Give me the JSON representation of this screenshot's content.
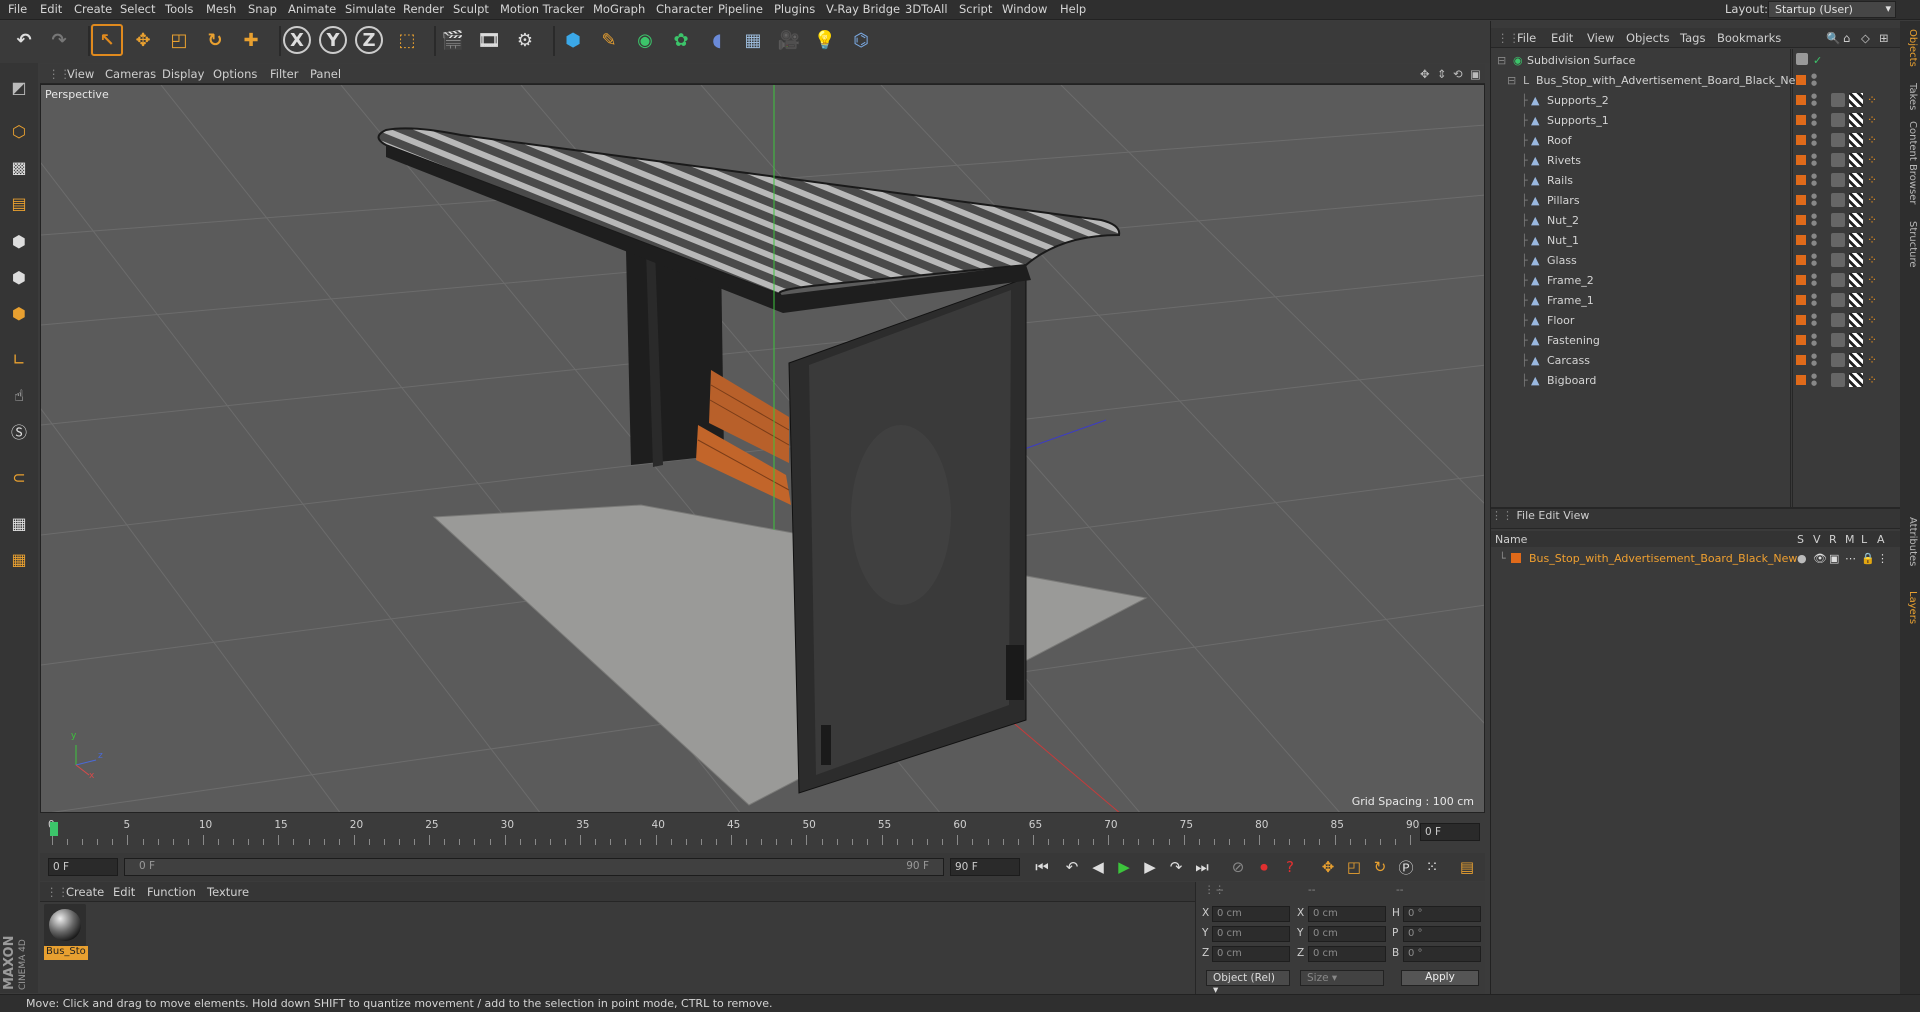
{
  "menubar": {
    "items": [
      "File",
      "Edit",
      "Create",
      "Select",
      "Tools",
      "Mesh",
      "Snap",
      "Animate",
      "Simulate",
      "Render",
      "Sculpt",
      "Motion Tracker",
      "MoGraph",
      "Character",
      "Pipeline",
      "Plugins",
      "V-Ray Bridge",
      "3DToAll",
      "Script",
      "Window",
      "Help"
    ],
    "layout_label": "Layout:",
    "layout_value": "Startup (User)"
  },
  "toolbar": {
    "x_label": "X",
    "y_label": "Y",
    "z_label": "Z"
  },
  "viewport": {
    "menu": [
      "View",
      "Cameras",
      "Display",
      "Options",
      "Filter",
      "Panel"
    ],
    "label": "Perspective",
    "grid_spacing": "Grid Spacing : 100 cm",
    "axis_y": "y",
    "axis_z": "z",
    "axis_x": "x"
  },
  "timeline": {
    "ticks": [
      "0",
      "5",
      "10",
      "15",
      "20",
      "25",
      "30",
      "35",
      "40",
      "45",
      "50",
      "55",
      "60",
      "65",
      "70",
      "75",
      "80",
      "85",
      "90"
    ],
    "current_frame_right": "0 F",
    "start_field": "0 F",
    "range_left": "0 F",
    "range_right": "90 F",
    "end_field": "90 F"
  },
  "material_panel": {
    "menu": [
      "Create",
      "Edit",
      "Function",
      "Texture"
    ],
    "material_name": "Bus_Sto"
  },
  "coord_panel": {
    "fields": {
      "pos_x": "0 cm",
      "pos_y": "0 cm",
      "pos_z": "0 cm",
      "size_x": "0 cm",
      "size_y": "0 cm",
      "size_z": "0 cm",
      "rot_h": "0 °",
      "rot_p": "0 °",
      "rot_b": "0 °"
    },
    "labels": {
      "x": "X",
      "y": "Y",
      "z": "Z",
      "h": "H",
      "p": "P",
      "b": "B"
    },
    "dash1": "--",
    "dash2": "--",
    "dash3": "--",
    "mode": "Object (Rel)",
    "size_mode": "Size",
    "apply": "Apply"
  },
  "object_manager": {
    "menu": [
      "File",
      "Edit",
      "View",
      "Objects",
      "Tags",
      "Bookmarks"
    ],
    "root": "Subdivision Surface",
    "group": "Bus_Stop_with_Advertisement_Board_Black_New",
    "children": [
      "Supports_2",
      "Supports_1",
      "Roof",
      "Rivets",
      "Rails",
      "Pillars",
      "Nut_2",
      "Nut_1",
      "Glass",
      "Frame_2",
      "Frame_1",
      "Floor",
      "Fastening",
      "Carcass",
      "Bigboard"
    ]
  },
  "layer_manager": {
    "menu": [
      "File",
      "Edit",
      "View"
    ],
    "header": {
      "name": "Name",
      "cols": [
        "S",
        "V",
        "R",
        "M",
        "L",
        "A"
      ]
    },
    "layer": "Bus_Stop_with_Advertisement_Board_Black_New"
  },
  "side_tabs": [
    "Objects",
    "Takes",
    "Content Browser",
    "Structure",
    "Attributes",
    "Layers"
  ],
  "status": "Move: Click and drag to move elements. Hold down SHIFT to quantize movement / add to the selection in point mode, CTRL to remove.",
  "brand": {
    "line1": "MAXON",
    "line2": "CINEMA 4D"
  },
  "colors": {
    "accent": "#e08a1e",
    "selection": "#f0a030",
    "grid": "#6a6a6a"
  }
}
